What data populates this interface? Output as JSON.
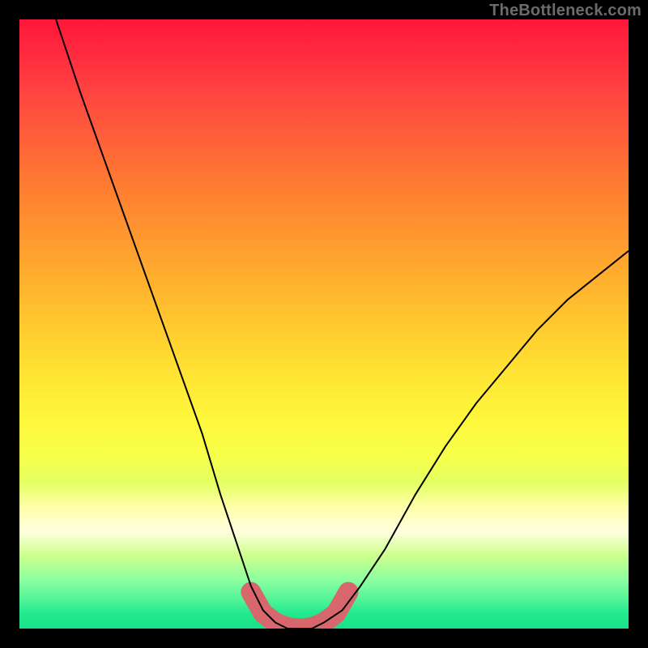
{
  "watermark": "TheBottleneck.com",
  "chart_data": {
    "type": "line",
    "title": "",
    "xlabel": "",
    "ylabel": "",
    "xlim": [
      0,
      100
    ],
    "ylim": [
      0,
      100
    ],
    "series": [
      {
        "name": "bottleneck-curve",
        "x": [
          6,
          10,
          15,
          20,
          25,
          30,
          33,
          36,
          38,
          40,
          42,
          44,
          46,
          48,
          50,
          53,
          56,
          60,
          65,
          70,
          75,
          80,
          85,
          90,
          95,
          100
        ],
        "values": [
          100,
          88,
          74,
          60,
          46,
          32,
          22,
          13,
          7,
          3,
          1,
          0,
          0,
          0,
          1,
          3,
          7,
          13,
          22,
          30,
          37,
          43,
          49,
          54,
          58,
          62
        ]
      }
    ],
    "highlight_band": {
      "name": "optimal-zone",
      "x": [
        38,
        40,
        42,
        44,
        46,
        48,
        50,
        52,
        54
      ],
      "values": [
        6,
        2.5,
        1,
        0.2,
        0,
        0.2,
        1,
        2.5,
        6
      ],
      "color": "#d8676d",
      "stroke_width_pct": 3.3
    }
  }
}
